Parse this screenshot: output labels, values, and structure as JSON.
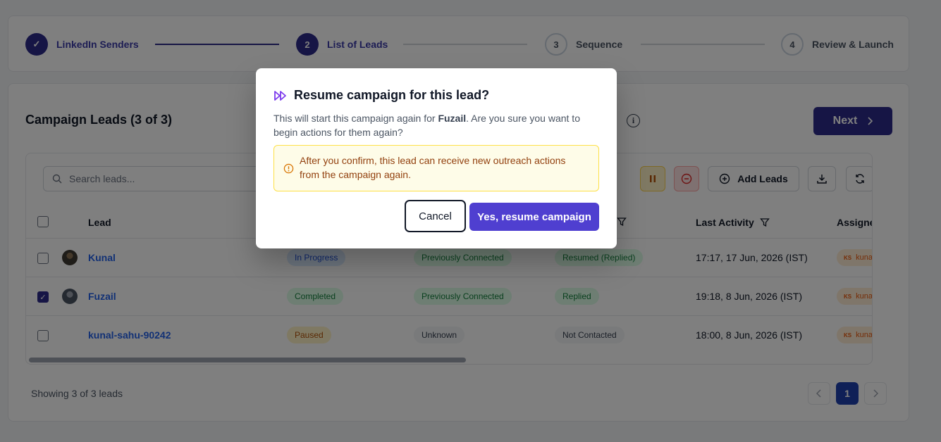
{
  "stepper": {
    "steps": [
      {
        "number": "✓",
        "label": "LinkedIn Senders",
        "state": "done"
      },
      {
        "number": "2",
        "label": "List of Leads",
        "state": "active"
      },
      {
        "number": "3",
        "label": "Sequence",
        "state": "todo"
      },
      {
        "number": "4",
        "label": "Review & Launch",
        "state": "todo"
      }
    ]
  },
  "header": {
    "title": "Campaign Leads (3 of 3)",
    "next_label": "Next"
  },
  "toolbar": {
    "search_placeholder": "Search leads...",
    "add_leads_label": "Add Leads"
  },
  "table": {
    "columns": [
      "Lead",
      "Last Activity",
      "Assigned Ac"
    ],
    "rows": [
      {
        "checked": false,
        "name": "Kunal",
        "status": "In Progress",
        "connection": "Previously Connected",
        "reply": "Resumed (Replied)",
        "last_activity": "17:17, 17 Jun, 2026 (IST)",
        "assignee_initials": "KS",
        "assignee": "kunal sa"
      },
      {
        "checked": true,
        "name": "Fuzail",
        "status": "Completed",
        "connection": "Previously Connected",
        "reply": "Replied",
        "last_activity": "19:18, 8 Jun, 2026 (IST)",
        "assignee_initials": "KS",
        "assignee": "kunal sa"
      },
      {
        "checked": false,
        "name": "kunal-sahu-90242",
        "status": "Paused",
        "connection": "Unknown",
        "reply": "Not Contacted",
        "last_activity": "18:00, 8 Jun, 2026 (IST)",
        "assignee_initials": "KS",
        "assignee": "kunal sa"
      }
    ]
  },
  "footer": {
    "showing": "Showing 3 of 3 leads",
    "current_page": "1"
  },
  "modal": {
    "title": "Resume campaign for this lead?",
    "body_prefix": "This will start this campaign again for ",
    "body_lead": "Fuzail",
    "body_suffix": ". Are you sure you want to begin actions for them again?",
    "warning": "After you confirm, this lead can receive new outreach actions from the campaign again.",
    "cancel_label": "Cancel",
    "confirm_label": "Yes, resume campaign"
  },
  "colors": {
    "primary": "#2d2a8a",
    "confirm": "#4f3fd0",
    "link": "#2563eb",
    "warning_bg": "#fefce8",
    "warning_text": "#92400e"
  }
}
